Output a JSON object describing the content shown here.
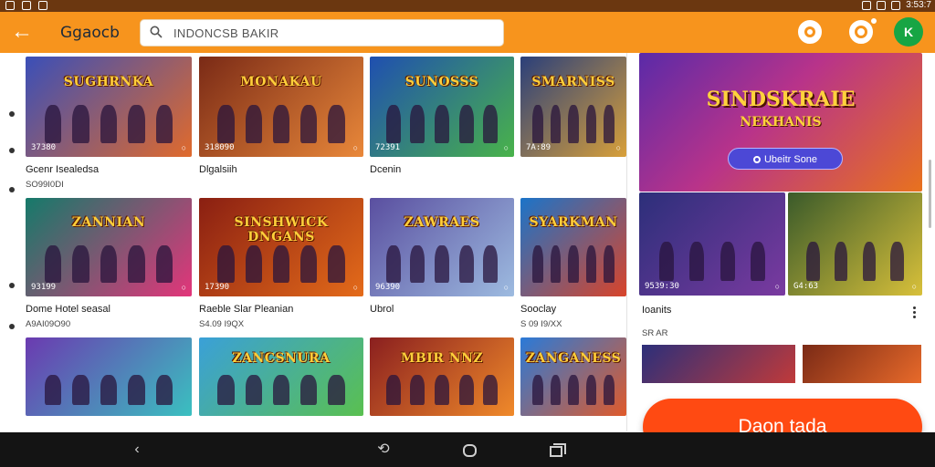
{
  "status_bar": {
    "time": "3:53:7"
  },
  "app_bar": {
    "brand": "Ggaocb",
    "search_placeholder": "INDONCSB BAKIR",
    "profile_icon": "person-icon",
    "notification_icon": "bell-icon",
    "account_icon": "k-icon",
    "account_initial": "K"
  },
  "grid": {
    "rows": [
      {
        "items": [
          {
            "title": "SUGHRNKA",
            "count": "37380",
            "caption": "Gcenr Isealedsa",
            "sub": "SO99I0DI",
            "colors": [
              "#3a4fb8",
              "#e06a2c"
            ]
          },
          {
            "title": "MONAKAU",
            "count": "318090",
            "caption": "Dlgalsiih",
            "sub": "",
            "colors": [
              "#7a2a16",
              "#e9883a"
            ]
          },
          {
            "title": "SUNOSSS",
            "count": "72391",
            "caption": "Dcenin",
            "sub": "",
            "colors": [
              "#1f4fb0",
              "#49b34a"
            ]
          },
          {
            "title": "SMARNISS",
            "count": "7A:89",
            "caption": "",
            "sub": "",
            "colors": [
              "#2a3f7a",
              "#d8a03a"
            ]
          }
        ]
      },
      {
        "items": [
          {
            "title": "ZANNIAN",
            "count": "93199",
            "caption": "Dome Hotel seasal",
            "sub": "A9AI09O90",
            "colors": [
              "#157a6a",
              "#e3357a"
            ]
          },
          {
            "title": "SINSHWICK DNGANS",
            "count": "17390",
            "caption": "Raeble Slar Pleanian",
            "sub": "S4.09 I9QX",
            "colors": [
              "#8a1f12",
              "#e46b1a"
            ]
          },
          {
            "title": "ZAWRAES",
            "count": "96390",
            "caption": "Ubrol",
            "sub": "",
            "colors": [
              "#5a4fa0",
              "#9dbbe0"
            ]
          },
          {
            "title": "SYARKMAN",
            "count": "",
            "caption": "Sooclay",
            "sub": "S 09 I9/XX",
            "colors": [
              "#1b74c9",
              "#d9442a"
            ]
          }
        ]
      },
      {
        "items": [
          {
            "title": "",
            "count": "",
            "caption": "",
            "sub": "",
            "colors": [
              "#6b3ab0",
              "#3ac0c0"
            ]
          },
          {
            "title": "ZANCSNURA",
            "count": "",
            "caption": "",
            "sub": "",
            "colors": [
              "#3aa0d8",
              "#5ac050"
            ]
          },
          {
            "title": "MBIR NNZ",
            "count": "",
            "caption": "",
            "sub": "",
            "colors": [
              "#8a1f1f",
              "#f08a2a"
            ]
          },
          {
            "title": "ZANGANESS",
            "count": "",
            "caption": "",
            "sub": "",
            "colors": [
              "#2a7ad8",
              "#e05a2a"
            ]
          }
        ]
      }
    ]
  },
  "side_panel": {
    "hero": {
      "title": "SINDSKRAIE",
      "subtitle": "NEKHANIS",
      "button": "Ubeitr Sone"
    },
    "tiles": [
      {
        "count": "9539:30",
        "colors": [
          "#2c2f7a",
          "#7a3aa0"
        ]
      },
      {
        "count": "G4:63",
        "colors": [
          "#3a5a2a",
          "#d8c03a"
        ]
      }
    ],
    "title": "Ioanits",
    "sub": "SR AR",
    "cta": "Daon tada"
  },
  "colors": {
    "accent": "#f7941d",
    "cta": "#ff4a12",
    "account": "#17a544",
    "hero_button": "#4c48d6"
  }
}
